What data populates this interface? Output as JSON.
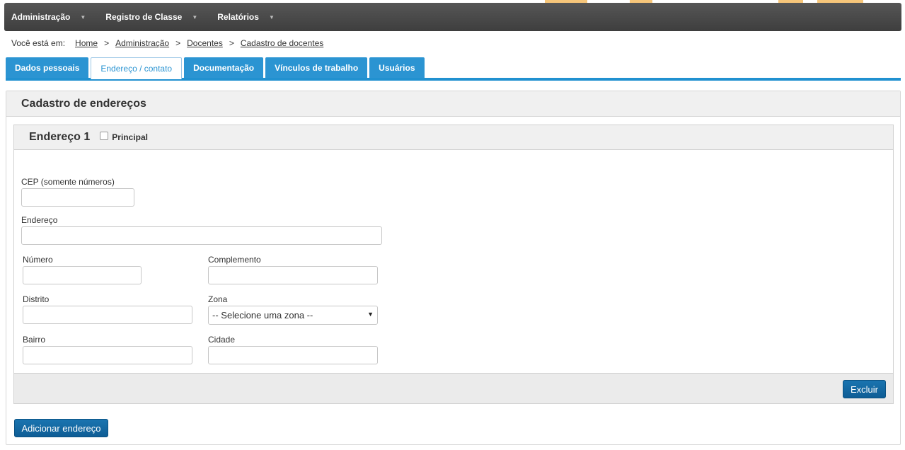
{
  "navbar": {
    "items": [
      {
        "label": "Administração"
      },
      {
        "label": "Registro de Classe"
      },
      {
        "label": "Relatórios"
      }
    ]
  },
  "breadcrumb": {
    "label": "Você está em:",
    "items": [
      "Home",
      "Administração",
      "Docentes",
      "Cadastro de docentes"
    ],
    "separator": ">"
  },
  "tabs": [
    {
      "label": "Dados pessoais",
      "active": false
    },
    {
      "label": "Endereço / contato",
      "active": true
    },
    {
      "label": "Documentação",
      "active": false
    },
    {
      "label": "Vínculos de trabalho",
      "active": false
    },
    {
      "label": "Usuários",
      "active": false
    }
  ],
  "panel": {
    "title": "Cadastro de endereços",
    "address": {
      "title": "Endereço 1",
      "principal_label": "Principal",
      "principal_checked": false,
      "fields": {
        "cep": {
          "label": "CEP (somente números)",
          "value": ""
        },
        "endereco": {
          "label": "Endereço",
          "value": ""
        },
        "numero": {
          "label": "Número",
          "value": ""
        },
        "complemento": {
          "label": "Complemento",
          "value": ""
        },
        "distrito": {
          "label": "Distrito",
          "value": ""
        },
        "zona": {
          "label": "Zona",
          "selected": "-- Selecione uma zona --"
        },
        "bairro": {
          "label": "Bairro",
          "value": ""
        },
        "cidade": {
          "label": "Cidade",
          "value": ""
        }
      },
      "delete_label": "Excluir"
    },
    "add_label": "Adicionar endereço"
  },
  "colors": {
    "navbar": "#4a4a4a",
    "tab": "#2b94d2",
    "button": "#1467a3"
  }
}
